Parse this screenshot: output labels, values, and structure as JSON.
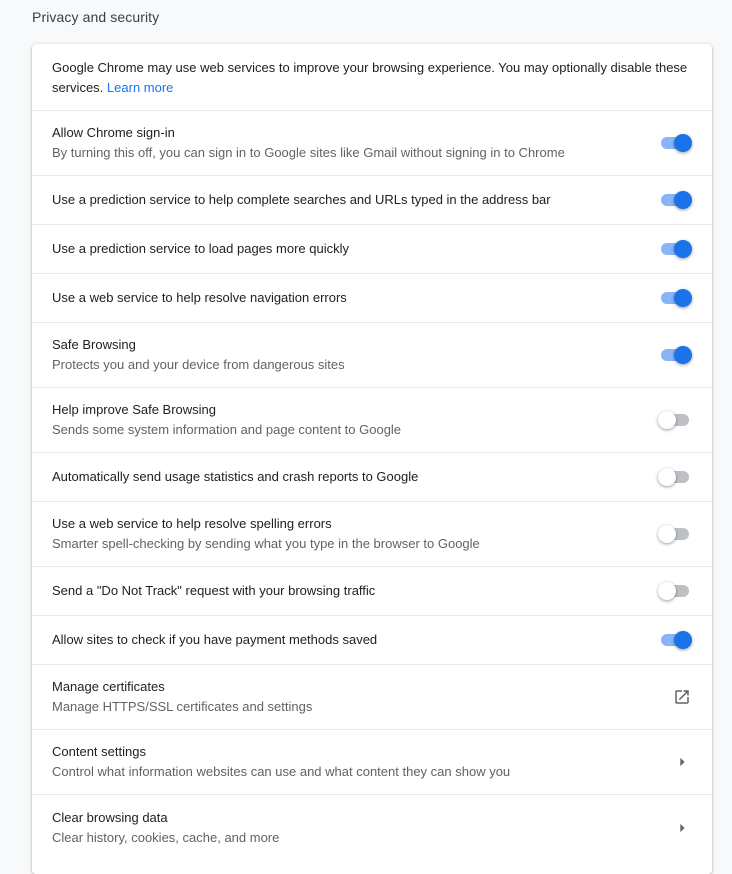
{
  "section": {
    "title": "Privacy and security"
  },
  "intro": {
    "text": "Google Chrome may use web services to improve your browsing experience. You may optionally disable these services.",
    "link_label": "Learn more"
  },
  "colors": {
    "accent": "#1a73e8",
    "toggle_on_track": "#8ab4f8",
    "toggle_off_track": "#bdc1c6"
  },
  "settings": [
    {
      "label": "Allow Chrome sign-in",
      "sublabel": "By turning this off, you can sign in to Google sites like Gmail without signing in to Chrome",
      "control": "toggle",
      "checked": true
    },
    {
      "label": "Use a prediction service to help complete searches and URLs typed in the address bar",
      "sublabel": "",
      "control": "toggle",
      "checked": true
    },
    {
      "label": "Use a prediction service to load pages more quickly",
      "sublabel": "",
      "control": "toggle",
      "checked": true
    },
    {
      "label": "Use a web service to help resolve navigation errors",
      "sublabel": "",
      "control": "toggle",
      "checked": true
    },
    {
      "label": "Safe Browsing",
      "sublabel": "Protects you and your device from dangerous sites",
      "control": "toggle",
      "checked": true
    },
    {
      "label": "Help improve Safe Browsing",
      "sublabel": "Sends some system information and page content to Google",
      "control": "toggle",
      "checked": false
    },
    {
      "label": "Automatically send usage statistics and crash reports to Google",
      "sublabel": "",
      "control": "toggle",
      "checked": false
    },
    {
      "label": "Use a web service to help resolve spelling errors",
      "sublabel": "Smarter spell-checking by sending what you type in the browser to Google",
      "control": "toggle",
      "checked": false
    },
    {
      "label": "Send a \"Do Not Track\" request with your browsing traffic",
      "sublabel": "",
      "control": "toggle",
      "checked": false
    },
    {
      "label": "Allow sites to check if you have payment methods saved",
      "sublabel": "",
      "control": "toggle",
      "checked": true
    },
    {
      "label": "Manage certificates",
      "sublabel": "Manage HTTPS/SSL certificates and settings",
      "control": "external-link",
      "icon": "open-in-new-icon"
    },
    {
      "label": "Content settings",
      "sublabel": "Control what information websites can use and what content they can show you",
      "control": "arrow",
      "icon": "arrow-right-icon"
    },
    {
      "label": "Clear browsing data",
      "sublabel": "Clear history, cookies, cache, and more",
      "control": "arrow",
      "icon": "arrow-right-icon"
    }
  ]
}
